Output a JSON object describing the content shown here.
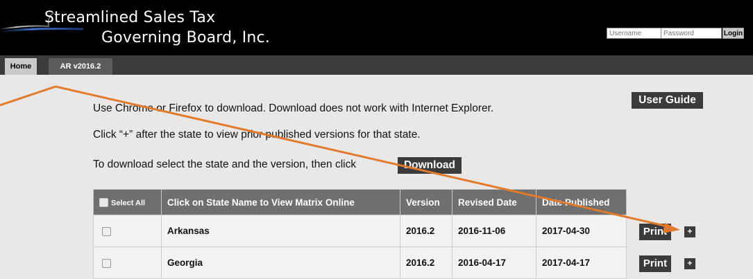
{
  "header": {
    "logo_line1": "Streamlined Sales Tax",
    "logo_line2": "Governing Board, Inc.",
    "username_placeholder": "Username",
    "password_placeholder": "Password",
    "login_label": "Login"
  },
  "nav": {
    "tabs": [
      {
        "label": "Home"
      },
      {
        "label": "AR v2016.2"
      }
    ]
  },
  "main": {
    "user_guide_label": "User Guide",
    "line1": "Use Chrome or Firefox to download. Download does not work with Internet Explorer.",
    "line2": "Click “+” after the state to view prior published versions for that state.",
    "line3": "To download select the state and the version, then click",
    "download_label": "Download"
  },
  "table": {
    "select_all_label": "Select All",
    "headers": [
      "Click on State Name to View Matrix Online",
      "Version",
      "Revised Date",
      "Date Published"
    ],
    "rows": [
      {
        "state": "Arkansas",
        "version": "2016.2",
        "revised": "2016-11-06",
        "published": "2017-04-30"
      },
      {
        "state": "Georgia",
        "version": "2016.2",
        "revised": "2016-04-17",
        "published": "2017-04-17"
      }
    ],
    "print_label": "Print",
    "plus_label": "+"
  },
  "colors": {
    "accent_arrow": "#e07a2c",
    "dark_button": "#3b3b3b",
    "table_header": "#6f6f6f",
    "page_bg": "#e9e8e7"
  }
}
